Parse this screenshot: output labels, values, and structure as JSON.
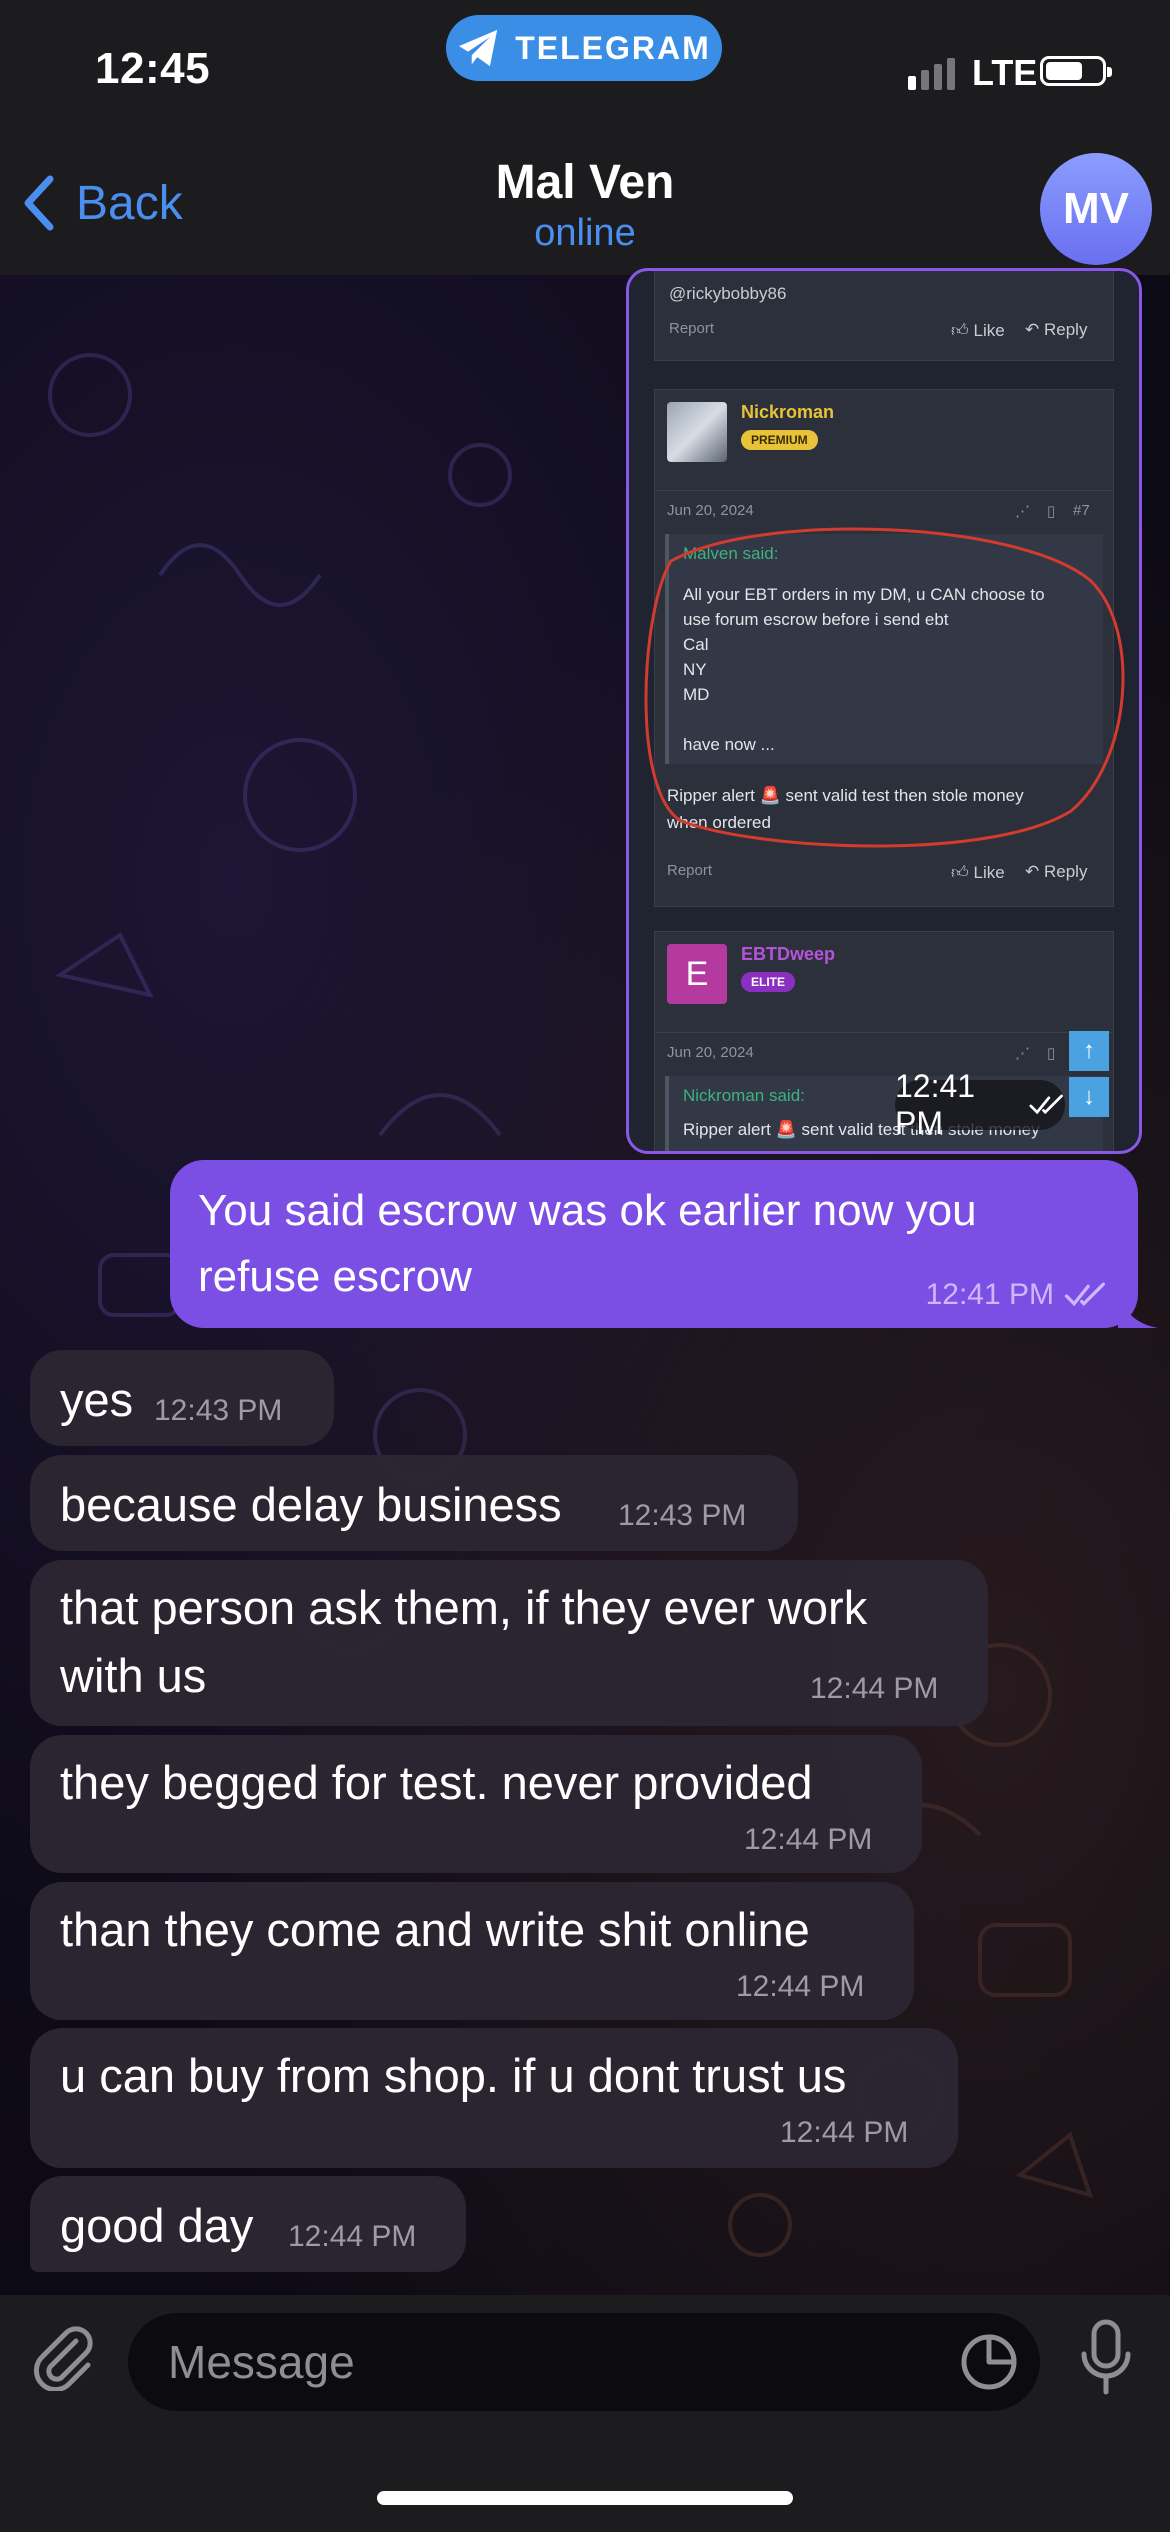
{
  "status_bar": {
    "time": "12:45",
    "app_pill": "TELEGRAM",
    "carrier": "LTE",
    "signal_bars_filled": 1,
    "battery_level": 0.6
  },
  "header": {
    "back_label": "Back",
    "chat_name": "Mal Ven",
    "chat_status": "online",
    "avatar_initials": "MV"
  },
  "screenshot_message": {
    "time": "12:41 PM",
    "forum": {
      "top_post": {
        "handle": "@rickybobby86",
        "report": "Report",
        "like": "Like",
        "reply": "Reply"
      },
      "post_7": {
        "username": "Nickroman",
        "badge": "PREMIUM",
        "date": "Jun 20, 2024",
        "post_number": "#7",
        "quote_author": "Malven said:",
        "quote_lines": [
          "All your EBT orders in my DM, u CAN choose to",
          "use forum escrow before i send ebt",
          "Cal",
          "NY",
          "MD",
          "",
          "have now ..."
        ],
        "body_lines": [
          "Ripper alert 🚨 sent valid test then stole money",
          "when ordered"
        ],
        "report": "Report",
        "like": "Like",
        "reply": "Reply"
      },
      "post_8": {
        "avatar_letter": "E",
        "username": "EBTDweep",
        "badge": "ELITE",
        "date": "Jun 20, 2024",
        "quote_author": "Nickroman said:",
        "quote_preview": "Ripper alert 🚨 sent valid test then stole money"
      }
    }
  },
  "outgoing_message": {
    "text_line1": "You said escrow was ok earlier now you",
    "text_line2": "refuse escrow",
    "time": "12:41 PM"
  },
  "incoming_messages": [
    {
      "text": "yes",
      "time": "12:43 PM"
    },
    {
      "text": "because delay business",
      "time": "12:43 PM"
    },
    {
      "text": "that person ask them, if they ever work",
      "text2": "with us",
      "time": "12:44 PM"
    },
    {
      "text": "they begged for test. never provided",
      "time": "12:44 PM"
    },
    {
      "text": "than they come and write shit online",
      "time": "12:44 PM"
    },
    {
      "text": "u can buy from shop. if u dont trust us",
      "time": "12:44 PM"
    },
    {
      "text": "good day",
      "time": "12:44 PM"
    }
  ],
  "composer": {
    "placeholder": "Message"
  },
  "colors": {
    "accent_blue": "#4a8ef0",
    "outgoing_bubble": "#7c4fe4",
    "incoming_bubble": "#2c2632",
    "telegram_pill": "#3a8ee6",
    "annotation_red": "#d23b2e",
    "forum_username_gold": "#e8c33a",
    "forum_username_purple": "#b454d8"
  },
  "icons": [
    "telegram-icon",
    "signal-icon",
    "battery-icon",
    "back-chevron-icon",
    "like-icon",
    "reply-icon",
    "share-icon",
    "bookmark-icon",
    "double-check-icon",
    "paperclip-icon",
    "sticker-icon",
    "microphone-icon"
  ]
}
